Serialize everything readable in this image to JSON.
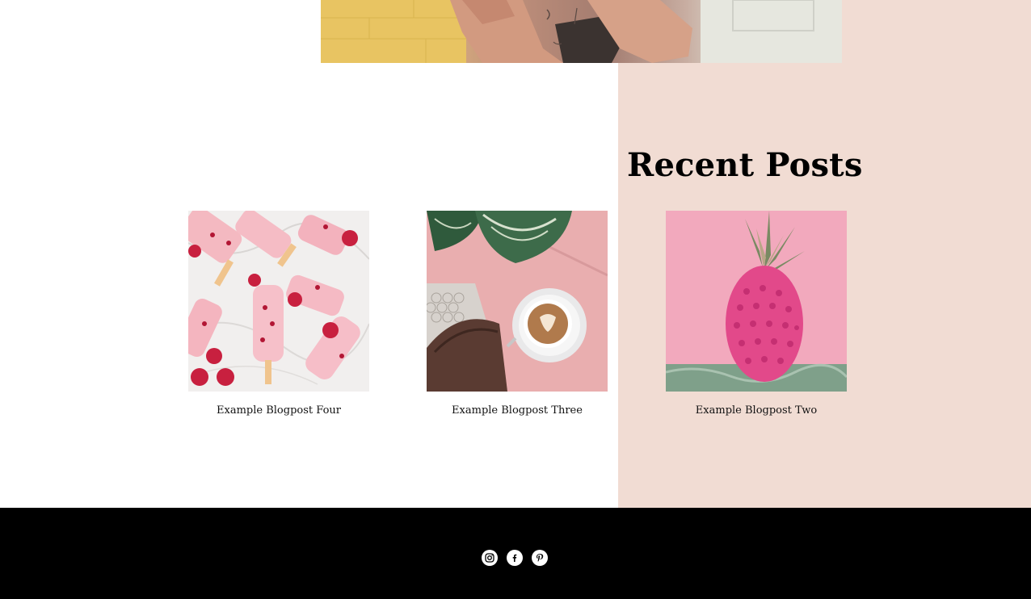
{
  "recent_posts": {
    "title": "Recent Posts",
    "posts": [
      {
        "title": "Example Blogpost Four",
        "image": "raspberry-popsicles"
      },
      {
        "title": "Example Blogpost Three",
        "image": "latte-on-pink-table"
      },
      {
        "title": "Example Blogpost Two",
        "image": "pink-pineapple"
      }
    ]
  },
  "footer": {
    "social": [
      "instagram-icon",
      "facebook-icon",
      "pinterest-icon"
    ]
  },
  "colors": {
    "accent_panel": "#f1dcd3",
    "footer_bg": "#000000"
  }
}
